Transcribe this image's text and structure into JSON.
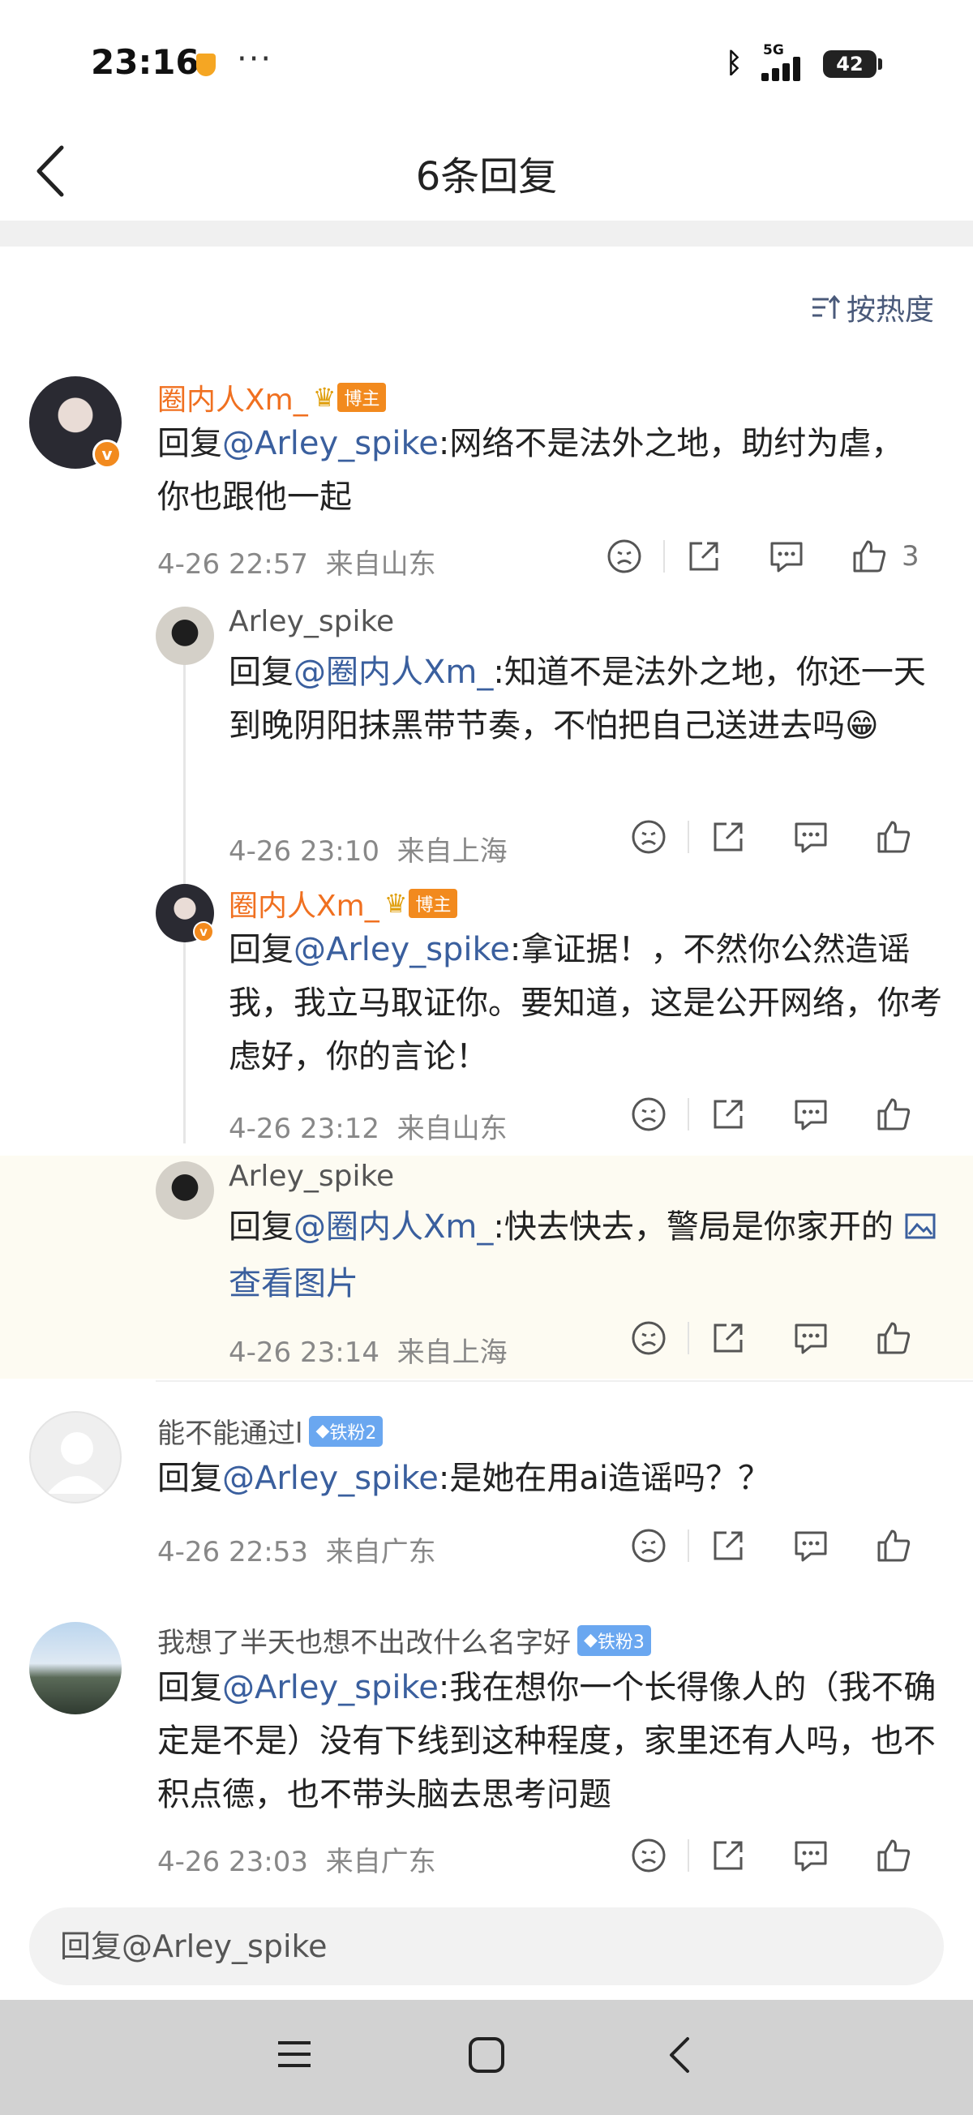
{
  "status_bar": {
    "time": "23:16",
    "dots": "···",
    "network": "5G",
    "battery": "42"
  },
  "header": {
    "title": "6条回复"
  },
  "sort": {
    "label": "按热度"
  },
  "comments": [
    {
      "name": "圈内人Xm_",
      "badge": "博主",
      "reply_prefix": "回复",
      "mention": "@Arley_spike",
      "text": ":网络不是法外之地，助纣为虐，你也跟他一起",
      "time": "4-26 22:57",
      "location": "来自山东",
      "likes": "3"
    },
    {
      "name": "Arley_spike",
      "reply_prefix": "回复",
      "mention": "@圈内人Xm_",
      "text": ":知道不是法外之地，你还一天到晚阴阳抹黑带节奏，不怕把自己送进去吗😁",
      "time": "4-26 23:10",
      "location": "来自上海"
    },
    {
      "name": "圈内人Xm_",
      "badge": "博主",
      "reply_prefix": "回复",
      "mention": "@Arley_spike",
      "text": ":拿证据！，不然你公然造谣我，我立马取证你。要知道，这是公开网络，你考虑好，你的言论！",
      "time": "4-26 23:12",
      "location": "来自山东"
    },
    {
      "name": "Arley_spike",
      "reply_prefix": "回复",
      "mention": "@圈内人Xm_",
      "text": ":快去快去，警局是你家开的",
      "image_link": "查看图片",
      "time": "4-26 23:14",
      "location": "来自上海"
    },
    {
      "name": "能不能通过l",
      "fan_badge": "铁粉2",
      "reply_prefix": "回复",
      "mention": "@Arley_spike",
      "text": ":是她在用ai造谣吗？？",
      "time": "4-26 22:53",
      "location": "来自广东"
    },
    {
      "name": "我想了半天也想不出改什么名字好",
      "fan_badge": "铁粉3",
      "reply_prefix": "回复",
      "mention": "@Arley_spike",
      "text": ":我在想你一个长得像人的（我不确定是不是）没有下线到这种程度，家里还有人吗，也不积点德，也不带头脑去思考问题",
      "time": "4-26 23:03",
      "location": "来自广东"
    }
  ],
  "reply_input": {
    "placeholder": "回复@Arley_spike"
  },
  "colors": {
    "accent_orange": "#f07020",
    "mention_blue": "#3a5f9e",
    "fan_badge": "#6aa7f0"
  },
  "icons": [
    "back-icon",
    "sort-icon",
    "dislike-icon",
    "share-icon",
    "comment-icon",
    "like-icon",
    "crown-icon",
    "diamond-icon",
    "image-icon",
    "menu-icon",
    "home-icon",
    "nav-back-icon"
  ]
}
